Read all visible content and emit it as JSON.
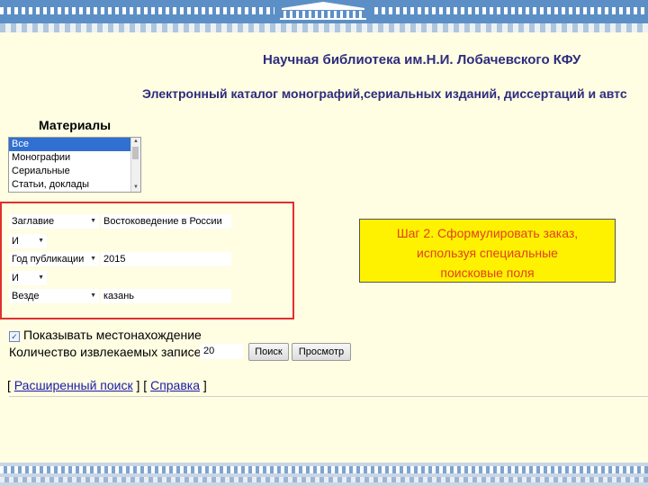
{
  "header": {
    "library_title": "Научная библиотека им.Н.И. Лобачевского КФУ",
    "catalog_title": "Электронный каталог монографий,сериальных изданий, диссертаций и автс"
  },
  "materials": {
    "label": "Материалы",
    "options": [
      "Все",
      "Монографии",
      "Сериальные",
      "Статьи, доклады"
    ],
    "selected": "Все"
  },
  "search_fields": [
    {
      "field": "Заглавие",
      "value": "Востоковедение в России"
    },
    {
      "operator": "И"
    },
    {
      "field": "Год публикации",
      "value": "2015"
    },
    {
      "operator": "И"
    },
    {
      "field": "Везде",
      "value": "казань"
    }
  ],
  "callout": {
    "line1": "Шаг 2. Сформулировать заказ,",
    "line2": "используя специальные",
    "line3": "поисковые поля"
  },
  "options": {
    "show_location_label": "Показывать местонахождение",
    "show_location_checked": true,
    "records_count_label": "Количество извлекаемых записей",
    "records_count_value": "20",
    "search_button": "Поиск",
    "browse_button": "Просмотр"
  },
  "links": {
    "open1": "[ ",
    "advanced": "Расширенный поиск",
    "sep": " ] [ ",
    "help": "Справка",
    "close": " ]"
  },
  "colors": {
    "background": "#fffde2",
    "title": "#2c2c7e",
    "frame": "#e03030",
    "callout_bg": "#fff200",
    "callout_text": "#e04020",
    "selected": "#3070d0",
    "link": "#1a1aa8"
  }
}
